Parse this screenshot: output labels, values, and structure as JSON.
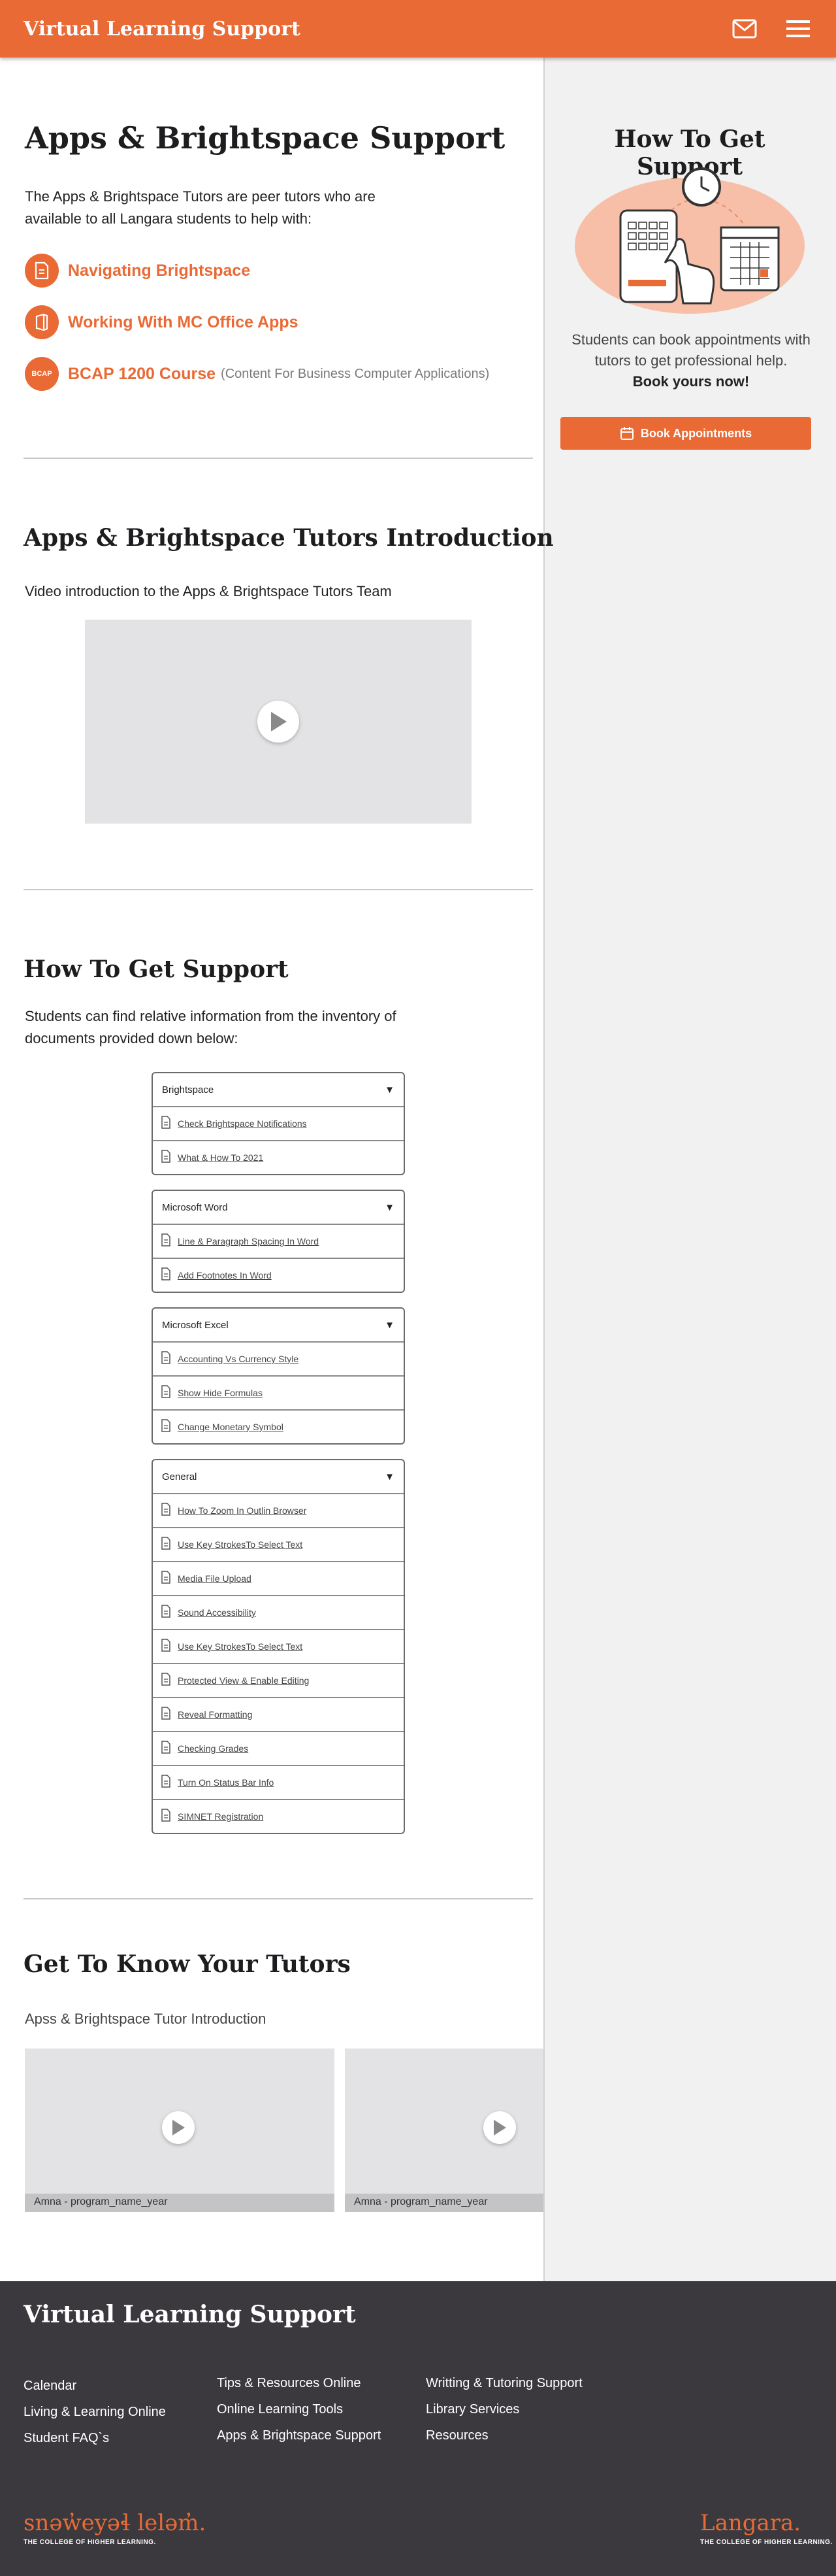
{
  "header": {
    "title": "Virtual Learning Support",
    "mail_icon": "mail-icon",
    "menu_icon": "menu-icon"
  },
  "colors": {
    "accent": "#e96a35",
    "footer_bg": "#3b393e",
    "sidebar_bg": "#f1f1f2"
  },
  "hero": {
    "title": "Apps & Brightspace Support",
    "description": "The Apps & Brightspace Tutors are peer tutors who are available to all Langara students to help with:",
    "topics": [
      {
        "label": "Navigating Brightspace",
        "icon": "document-icon",
        "note": ""
      },
      {
        "label": "Working With MC Office Apps",
        "icon": "office-icon",
        "note": ""
      },
      {
        "label": "BCAP 1200 Course",
        "icon": "bcap-icon",
        "icon_text": "BCAP",
        "note": "(Content For Business Computer Applications)"
      }
    ]
  },
  "intro": {
    "title": "Apps & Brightspace Tutors Introduction",
    "text": "Video introduction to the Apps & Brightspace Tutors Team"
  },
  "support": {
    "title": "How To Get Support",
    "text": "Students can find relative information from the inventory of documents provided down below:",
    "groups": [
      {
        "title": "Brightspace",
        "items": [
          "Check Brightspace Notifications",
          "What & How To 2021"
        ]
      },
      {
        "title": "Microsoft Word",
        "items": [
          "Line & Paragraph Spacing In Word",
          "Add Footnotes In Word"
        ]
      },
      {
        "title": "Microsoft Excel",
        "items": [
          "Accounting Vs Currency Style",
          "Show Hide Formulas",
          "Change Monetary Symbol"
        ]
      },
      {
        "title": "General",
        "items": [
          "How To Zoom In Outlin Browser",
          "Use Key StrokesTo Select Text",
          "Media File Upload",
          "Sound Accessibility",
          "Use Key StrokesTo Select Text",
          "Protected View & Enable Editing",
          "Reveal Formatting",
          "Checking Grades",
          "Turn On Status Bar Info",
          "SIMNET Registration"
        ]
      }
    ]
  },
  "tutors": {
    "title": "Get To Know Your Tutors",
    "subtitle": "Apss & Brightspace Tutor Introduction",
    "cards": [
      {
        "caption": "Amna - program_name_year"
      },
      {
        "caption": "Amna - program_name_year"
      }
    ]
  },
  "sidebar": {
    "title": "How To Get Support",
    "text_1": "Students can book appointments with tutors to get professional help.",
    "text_2": "Book yours now!",
    "button": "Book Appointments"
  },
  "footer": {
    "title": "Virtual Learning Support",
    "col1": [
      "Calendar",
      "Living & Learning Online",
      "Student FAQ`s"
    ],
    "col2": [
      "Tips & Resources Online",
      "Online Learning Tools",
      "Apps & Brightspace Support"
    ],
    "col3": [
      "Writting & Tutoring Support",
      "Library Services",
      "Resources"
    ],
    "logo_left": "snəw̓eyəɬ leləm̓.",
    "logo_left_sub": "THE COLLEGE OF HIGHER LEARNING.",
    "logo_right": "Langara.",
    "logo_right_sub": "THE COLLEGE OF HIGHER LEARNING."
  }
}
